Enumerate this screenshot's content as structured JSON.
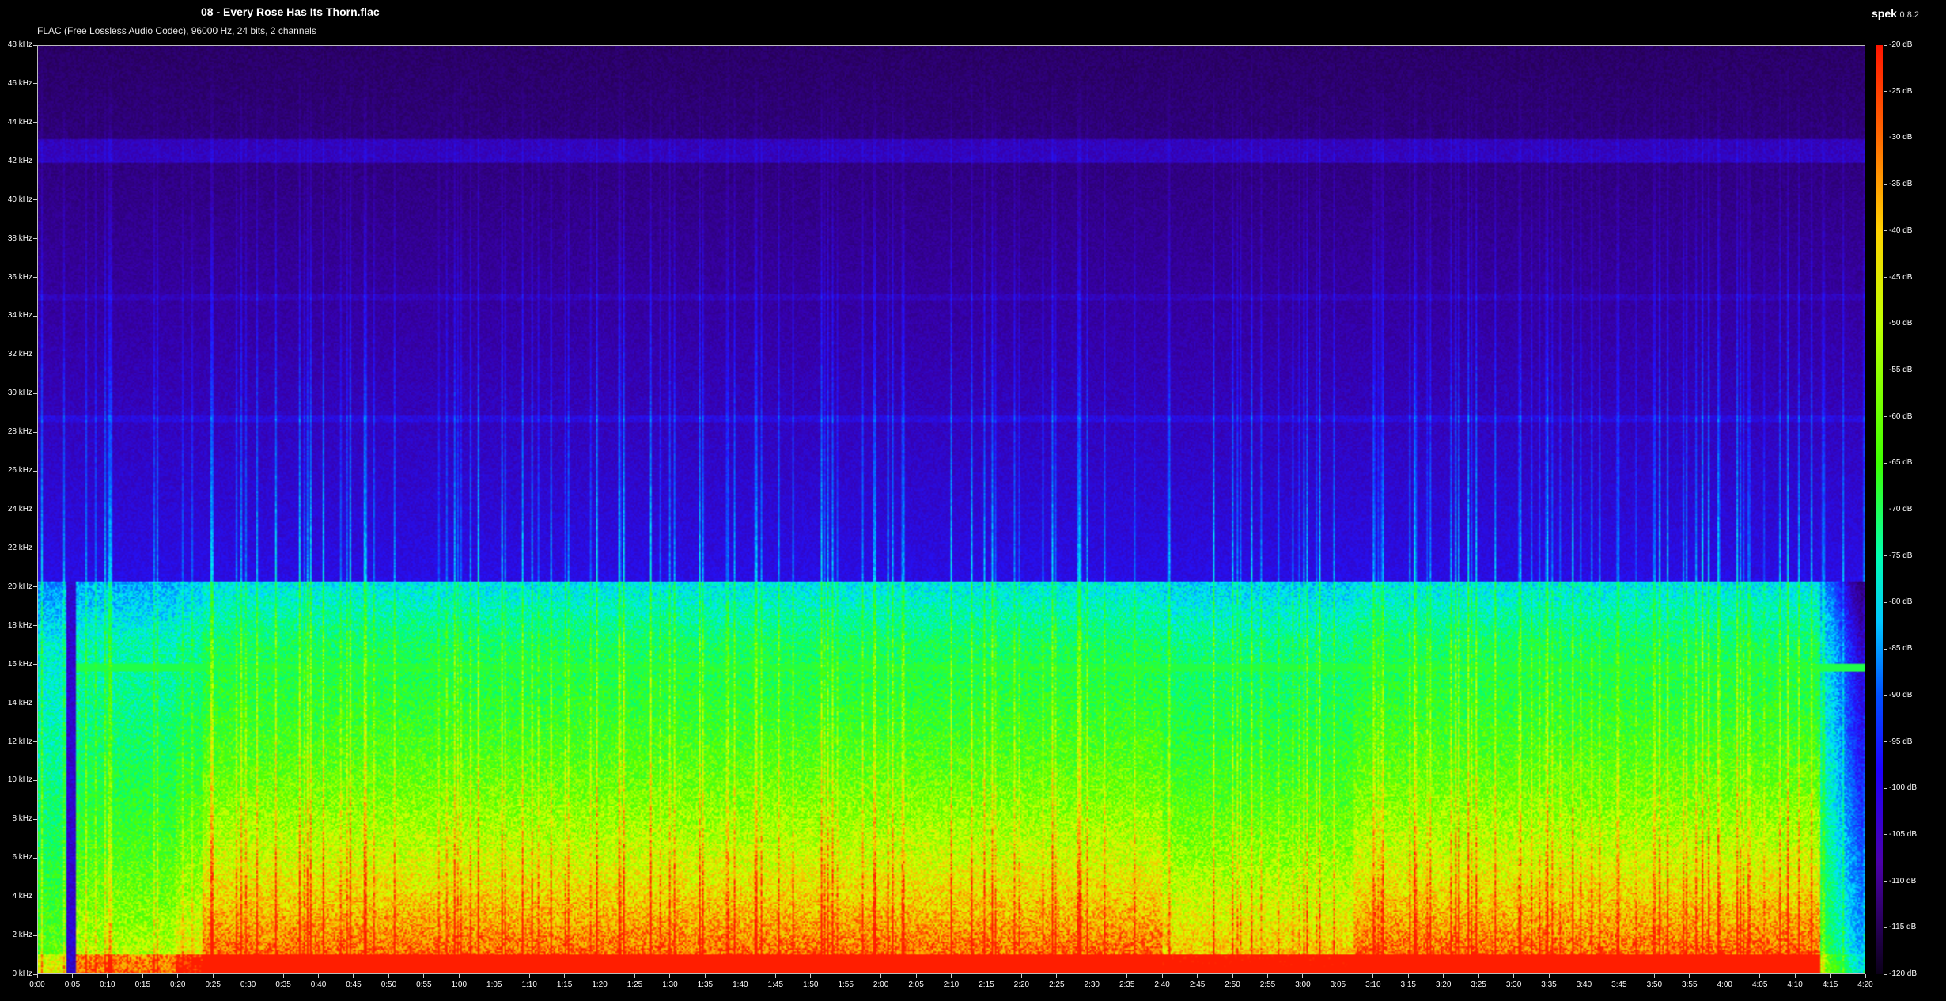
{
  "header": {
    "title": "08 - Every Rose Has Its Thorn.flac",
    "subtitle": "FLAC (Free Lossless Audio Codec), 96000 Hz, 24 bits, 2 channels",
    "app_name": "spek",
    "app_version": "0.8.2"
  },
  "freq_axis": {
    "labels": [
      "48 kHz",
      "46 kHz",
      "44 kHz",
      "42 kHz",
      "40 kHz",
      "38 kHz",
      "36 kHz",
      "34 kHz",
      "32 kHz",
      "30 kHz",
      "28 kHz",
      "26 kHz",
      "24 kHz",
      "22 kHz",
      "20 kHz",
      "18 kHz",
      "16 kHz",
      "14 kHz",
      "12 kHz",
      "10 kHz",
      "8 kHz",
      "6 kHz",
      "4 kHz",
      "2 kHz",
      "0 kHz"
    ]
  },
  "time_axis": {
    "labels": [
      "0:00",
      "0:05",
      "0:10",
      "0:15",
      "0:20",
      "0:25",
      "0:30",
      "0:35",
      "0:40",
      "0:45",
      "0:50",
      "0:55",
      "1:00",
      "1:05",
      "1:10",
      "1:15",
      "1:20",
      "1:25",
      "1:30",
      "1:35",
      "1:40",
      "1:45",
      "1:50",
      "1:55",
      "2:00",
      "2:05",
      "2:10",
      "2:15",
      "2:20",
      "2:25",
      "2:30",
      "2:35",
      "2:40",
      "2:45",
      "2:50",
      "2:55",
      "3:00",
      "3:05",
      "3:10",
      "3:15",
      "3:20",
      "3:25",
      "3:30",
      "3:35",
      "3:40",
      "3:45",
      "3:50",
      "3:55",
      "4:00",
      "4:05",
      "4:10",
      "4:15",
      "4:20"
    ]
  },
  "db_axis": {
    "labels": [
      "-20 dB",
      "-25 dB",
      "-30 dB",
      "-35 dB",
      "-40 dB",
      "-45 dB",
      "-50 dB",
      "-55 dB",
      "-60 dB",
      "-65 dB",
      "-70 dB",
      "-75 dB",
      "-80 dB",
      "-85 dB",
      "-90 dB",
      "-95 dB",
      "-100 dB",
      "-105 dB",
      "-110 dB",
      "-115 dB",
      "-120 dB"
    ]
  },
  "colors": {
    "background": "#000000",
    "border": "#bbbbbb",
    "text": "#ffffff"
  }
}
